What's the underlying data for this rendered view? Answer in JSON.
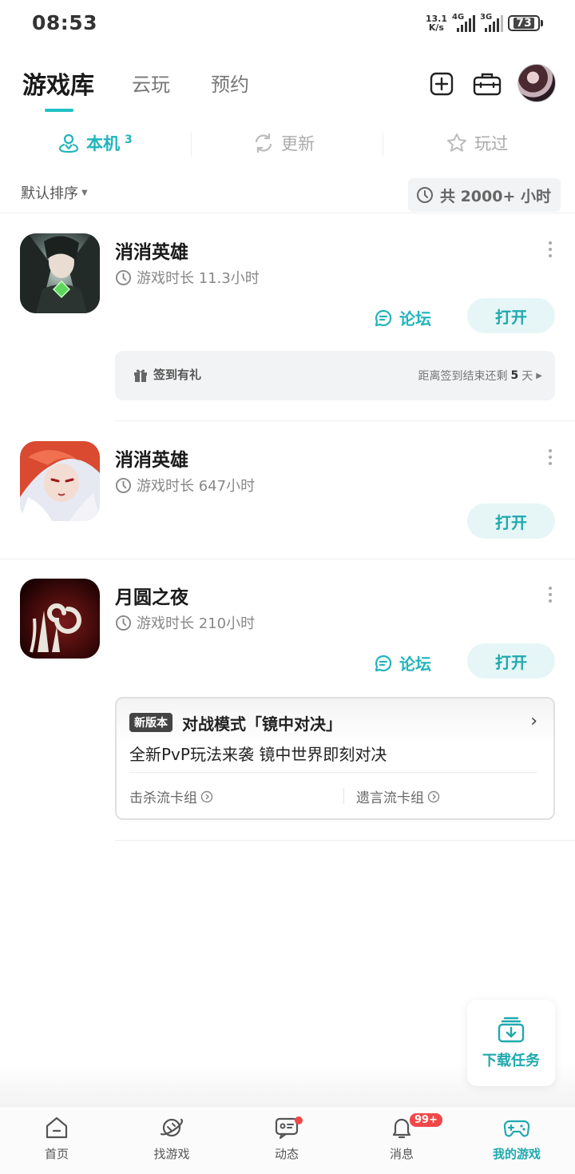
{
  "status_bar": {
    "time": "08:53",
    "net_speed_value": "13.1",
    "net_speed_unit": "K/s",
    "sim1_label": "4G",
    "sim2_label": "3G",
    "battery": "73"
  },
  "header": {
    "tabs": [
      {
        "label": "游戏库"
      },
      {
        "label": "云玩"
      },
      {
        "label": "预约"
      }
    ]
  },
  "subtabs": [
    {
      "label": "本机",
      "count": "3"
    },
    {
      "label": "更新"
    },
    {
      "label": "玩过"
    }
  ],
  "sort": {
    "label": "默认排序",
    "total_time": "共 2000+ 小时"
  },
  "games": [
    {
      "name": "消消英雄",
      "playtime": "游戏时长 11.3小时",
      "forum_label": "论坛",
      "open_label": "打开",
      "signin": {
        "label": "签到有礼",
        "remaining_prefix": "距离签到结束还剩",
        "remaining_days": "5",
        "remaining_suffix": "天"
      }
    },
    {
      "name": "消消英雄",
      "playtime": "游戏时长 647小时",
      "open_label": "打开"
    },
    {
      "name": "月圆之夜",
      "playtime": "游戏时长 210小时",
      "forum_label": "论坛",
      "open_label": "打开",
      "news": {
        "badge": "新版本",
        "title": "对战模式「镜中对决」",
        "subtitle": "全新PvP玩法来袭 镜中世界即刻对决",
        "links": [
          "击杀流卡组",
          "遗言流卡组"
        ]
      }
    }
  ],
  "download_fab": {
    "label": "下载任务"
  },
  "bottom_nav": [
    {
      "label": "首页",
      "icon": "home-icon"
    },
    {
      "label": "找游戏",
      "icon": "planet-icon"
    },
    {
      "label": "动态",
      "icon": "feed-icon"
    },
    {
      "label": "消息",
      "icon": "bell-icon",
      "badge": "99+"
    },
    {
      "label": "我的游戏",
      "icon": "gamepad-icon"
    }
  ],
  "colors": {
    "accent": "#20b5bb",
    "badge_red": "#f04848"
  }
}
